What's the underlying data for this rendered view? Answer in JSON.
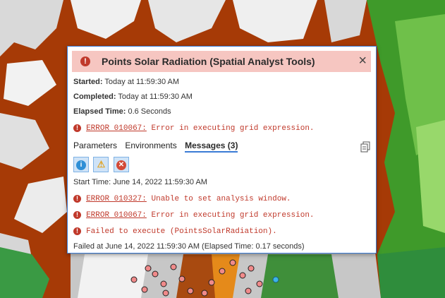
{
  "dialog": {
    "title": "Points Solar Radiation (Spatial Analyst Tools)",
    "close_label": "×",
    "started_label": "Started:",
    "started_value": "Today at 11:59:30 AM",
    "completed_label": "Completed:",
    "completed_value": "Today at 11:59:30 AM",
    "elapsed_label": "Elapsed Time:",
    "elapsed_value": "0.6 Seconds",
    "main_error": {
      "code": "ERROR 010067:",
      "text": "Error in executing grid expression."
    }
  },
  "tabs": [
    {
      "label": "Parameters"
    },
    {
      "label": "Environments"
    },
    {
      "label": "Messages (3)"
    }
  ],
  "filters": [
    {
      "icon": "info-icon",
      "color": "#2f8fd6"
    },
    {
      "icon": "warning-icon",
      "color": "#e0a528"
    },
    {
      "icon": "error-icon",
      "color": "#d34836"
    }
  ],
  "messages": {
    "start_time": "Start Time: June 14, 2022 11:59:30 AM",
    "items": [
      {
        "code": "ERROR 010327:",
        "text": "Unable to set analysis window."
      },
      {
        "code": "ERROR 010067:",
        "text": "Error in executing grid expression."
      },
      {
        "code": "",
        "text": "Failed to execute (PointsSolarRadiation)."
      }
    ],
    "footer": "Failed at June 14, 2022 11:59:30 AM (Elapsed Time: 0.17 seconds)"
  },
  "colors": {
    "error": "#c0392b",
    "accent": "#3a7bd5",
    "title_bg": "#f6c6c1"
  }
}
